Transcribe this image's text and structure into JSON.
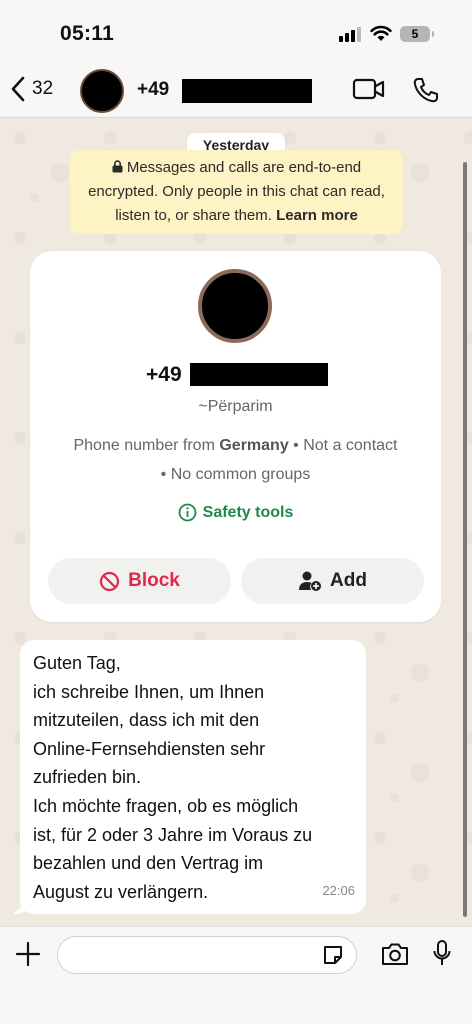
{
  "status_bar": {
    "time": "05:11",
    "battery_level": "5"
  },
  "header": {
    "back_count": "32",
    "contact_prefix": "+49",
    "icons": [
      "chevron-left-icon",
      "video-call-icon",
      "phone-call-icon"
    ]
  },
  "chat": {
    "date_label": "Yesterday",
    "encryption_text": "Messages and calls are end-to-end encrypted. Only people in this chat can read, listen to, or share them.",
    "learn_more": "Learn more"
  },
  "contact_card": {
    "phone_prefix": "+49",
    "push_name": "~Përparim",
    "info_prefix": "Phone number from",
    "country": "Germany",
    "info_suffix": "• Not a contact • No common groups",
    "safety_tools": "Safety tools",
    "block_label": "Block",
    "add_label": "Add"
  },
  "message": {
    "lines": [
      "Guten Tag,",
      "ich schreibe Ihnen, um Ihnen",
      "mitzuteilen, dass ich mit den",
      "Online-Fernsehdiensten sehr",
      "zufrieden bin.",
      "Ich möchte fragen, ob es möglich",
      "ist, für 2 oder 3 Jahre im Voraus zu",
      "bezahlen und den Vertrag im",
      "August zu verlängern."
    ],
    "time": "22:06"
  },
  "input_bar": {
    "value": "",
    "placeholder": ""
  },
  "colors": {
    "accent_green": "#1f8a4c",
    "block_red": "#e0284a",
    "encryption_bg": "#fdf3c5",
    "chat_bg": "#efe9df"
  }
}
